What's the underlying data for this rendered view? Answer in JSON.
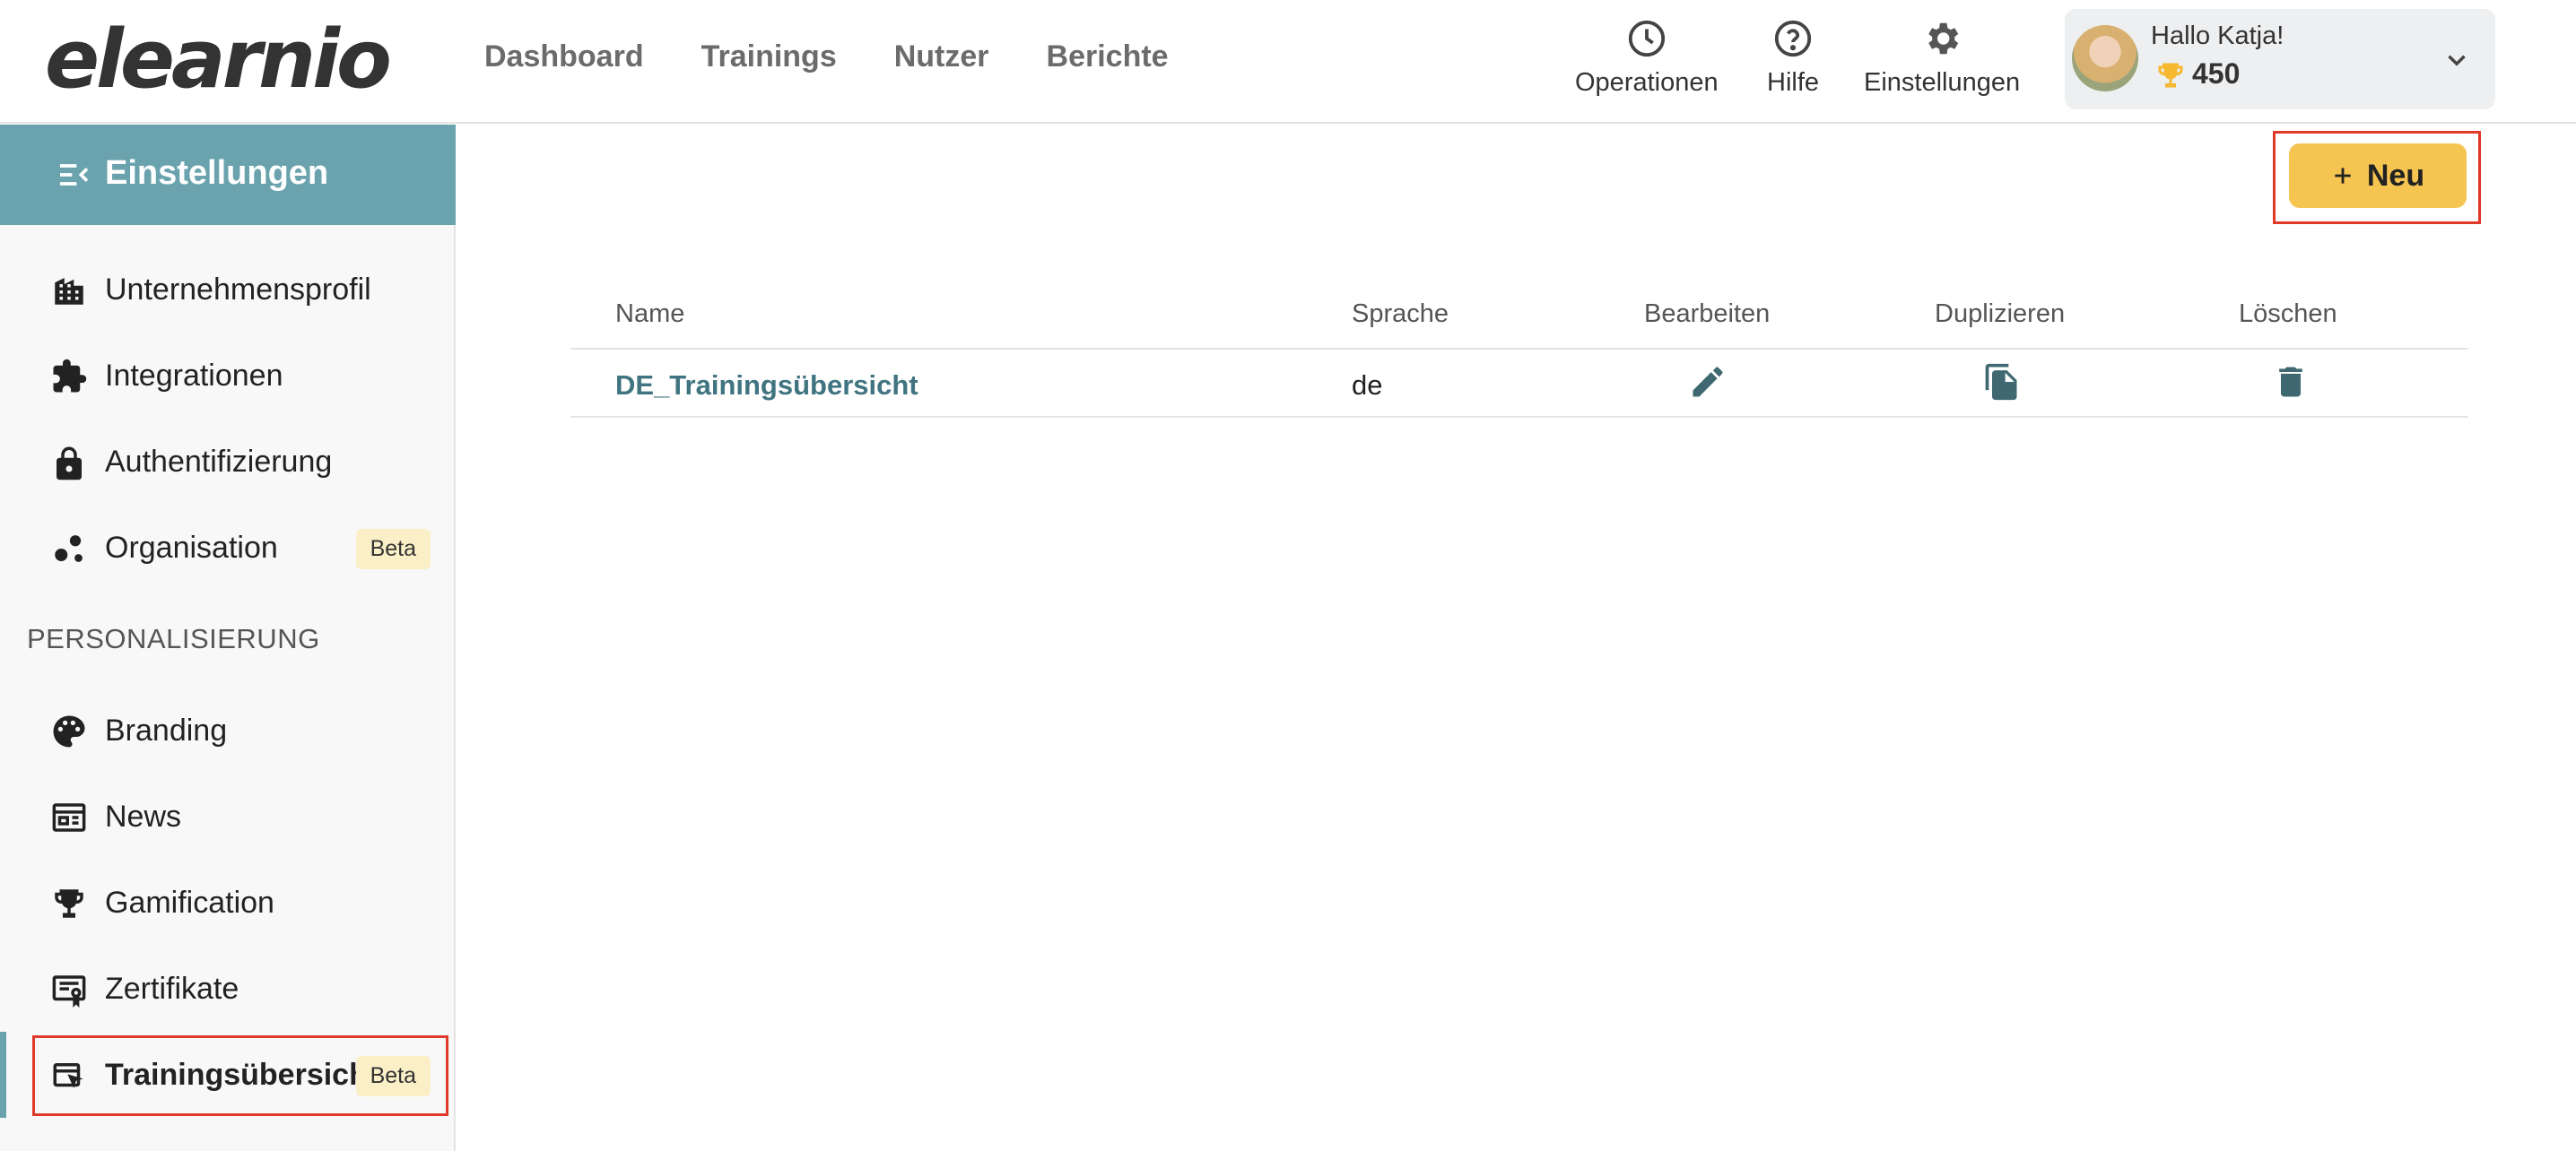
{
  "header": {
    "logo_text": "elearnio",
    "nav": [
      "Dashboard",
      "Trainings",
      "Nutzer",
      "Berichte"
    ],
    "tools": {
      "operations": {
        "label": "Operationen",
        "icon": "clock-icon"
      },
      "help": {
        "label": "Hilfe",
        "icon": "help-circle-icon"
      },
      "settings": {
        "label": "Einstellungen",
        "icon": "gear-icon"
      }
    },
    "user": {
      "greeting": "Hallo Katja!",
      "points": "450",
      "points_icon": "trophy-icon"
    }
  },
  "sidebar": {
    "title": "Einstellungen",
    "items": [
      {
        "label": "Unternehmensprofil",
        "icon": "building-icon"
      },
      {
        "label": "Integrationen",
        "icon": "puzzle-icon"
      },
      {
        "label": "Authentifizierung",
        "icon": "lock-icon"
      },
      {
        "label": "Organisation",
        "icon": "organization-icon",
        "badge": "Beta"
      }
    ],
    "section_title": "PERSONALISIERUNG",
    "section_items": [
      {
        "label": "Branding",
        "icon": "palette-icon"
      },
      {
        "label": "News",
        "icon": "newspaper-icon"
      },
      {
        "label": "Gamification",
        "icon": "trophy-icon"
      },
      {
        "label": "Zertifikate",
        "icon": "certificate-icon"
      },
      {
        "label": "Trainingsübersicht",
        "icon": "training-overview-icon",
        "badge": "Beta",
        "active": true
      }
    ]
  },
  "main": {
    "new_button": "Neu",
    "table": {
      "headers": {
        "name": "Name",
        "language": "Sprache",
        "edit": "Bearbeiten",
        "duplicate": "Duplizieren",
        "delete": "Löschen"
      },
      "rows": [
        {
          "name": "DE_Trainingsübersicht",
          "language": "de"
        }
      ]
    }
  },
  "colors": {
    "accent_teal": "#6aa3ae",
    "button_yellow": "#f5c451",
    "highlight_red": "#e0392a",
    "link_teal": "#3f7480",
    "badge_bg": "#fbefc7"
  }
}
